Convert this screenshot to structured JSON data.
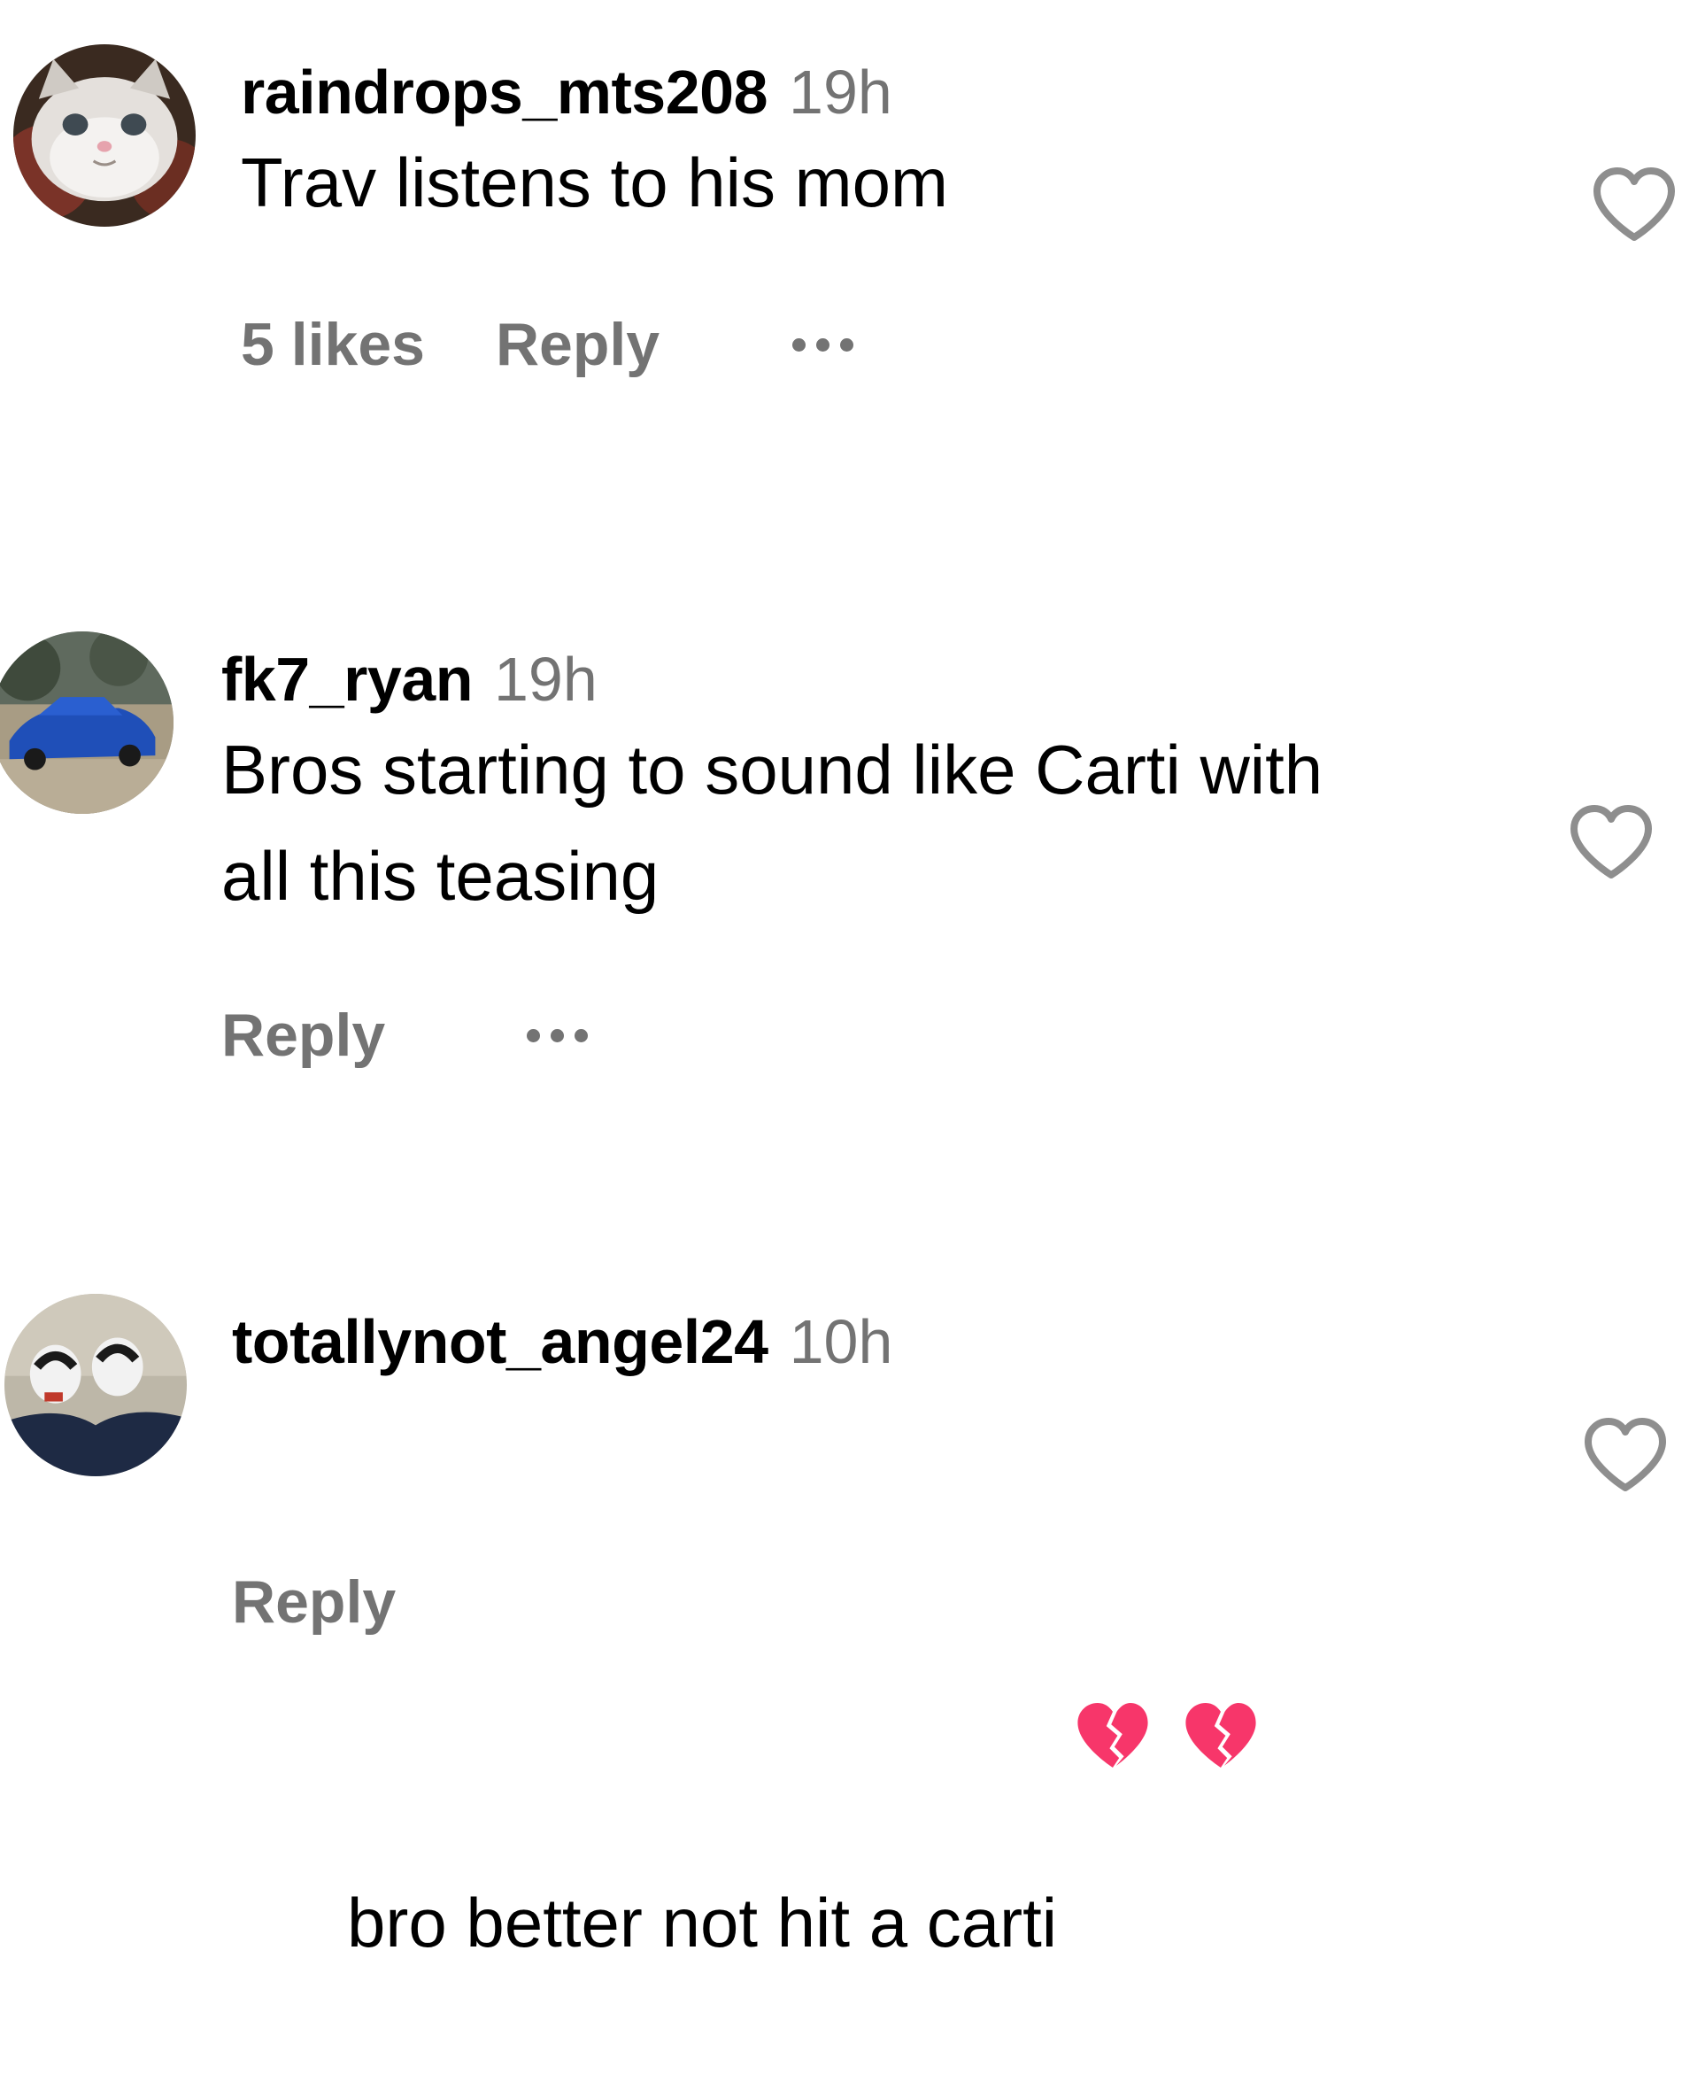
{
  "comments": [
    {
      "username": "raindrops_mts208",
      "time": "19h",
      "text": "Trav listens to his mom",
      "likes": "5 likes",
      "reply": "Reply",
      "avatar": "cat-avatar-icon"
    },
    {
      "username": "fk7_ryan",
      "time": "19h",
      "text": "Bros starting to sound like Carti with\nall this teasing",
      "reply": "Reply",
      "avatar": "blue-car-avatar-icon"
    },
    {
      "username": "totallynot_angel24",
      "time": "10h",
      "text": "bro better not hit a carti",
      "reply": "Reply",
      "avatar": "sneakers-avatar-icon",
      "emojis": [
        "broken-heart-icon",
        "broken-heart-icon"
      ]
    }
  ],
  "colors": {
    "secondary_text": "#737373",
    "heart_outline": "#8e8e8e",
    "broken_heart": "#f7366a"
  }
}
